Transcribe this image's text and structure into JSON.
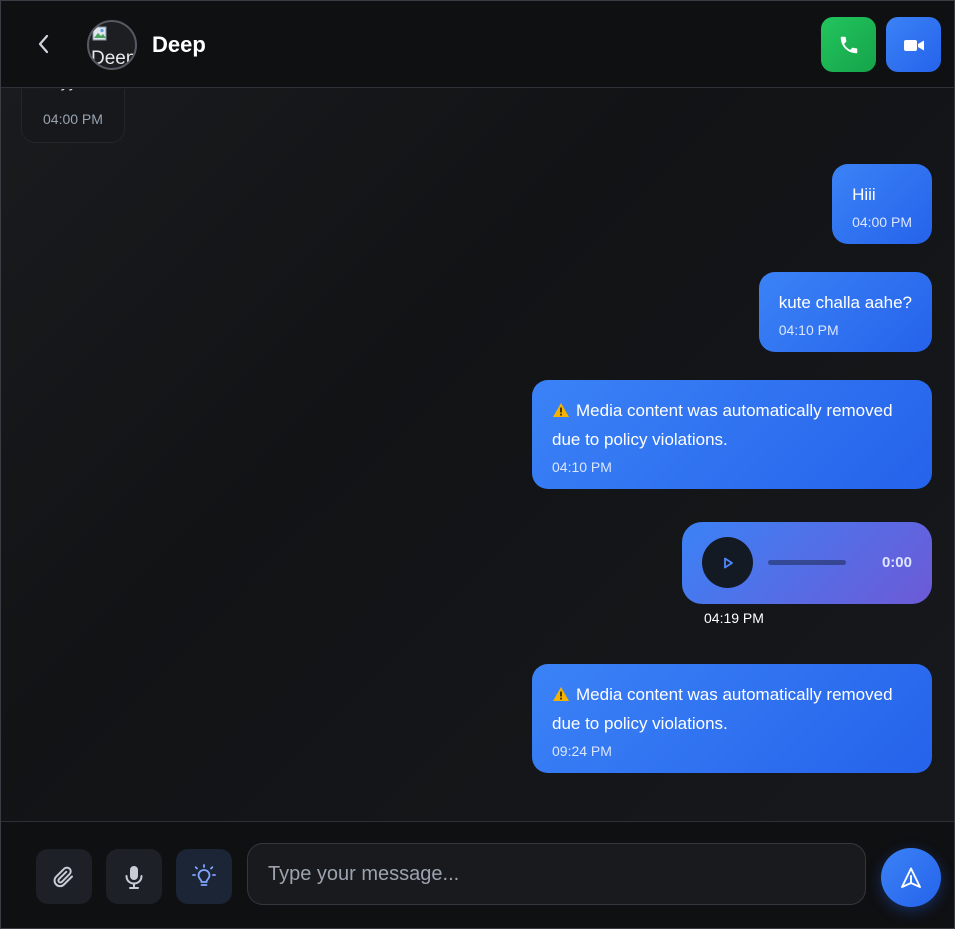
{
  "header": {
    "contact_name": "Deep",
    "avatar_alt": "Deep"
  },
  "messages": [
    {
      "direction": "incoming",
      "text": "heyy",
      "time": "04:00 PM"
    },
    {
      "direction": "outgoing",
      "text": "Hiii",
      "time": "04:00 PM"
    },
    {
      "direction": "outgoing",
      "text": "kute challa aahe?",
      "time": "04:10 PM"
    },
    {
      "direction": "outgoing",
      "text": "Media content was automatically removed due to policy violations.",
      "time": "04:10 PM",
      "warning": true
    },
    {
      "direction": "outgoing",
      "type": "voice",
      "duration": "0:00",
      "time": "04:19 PM"
    },
    {
      "direction": "outgoing",
      "text": "Media content was automatically removed due to policy violations.",
      "time": "09:24 PM",
      "warning": true
    }
  ],
  "composer": {
    "placeholder": "Type your message...",
    "value": ""
  },
  "icons": {
    "back": "chevron-left-icon",
    "call": "phone-icon",
    "video": "video-camera-icon",
    "attach": "paperclip-icon",
    "mic": "microphone-icon",
    "idea": "lightbulb-icon",
    "send": "send-icon",
    "play": "play-icon",
    "warning": "warning-icon"
  },
  "colors": {
    "accent": "#3b82f6",
    "call_green": "#22c55e",
    "background": "#121315"
  }
}
